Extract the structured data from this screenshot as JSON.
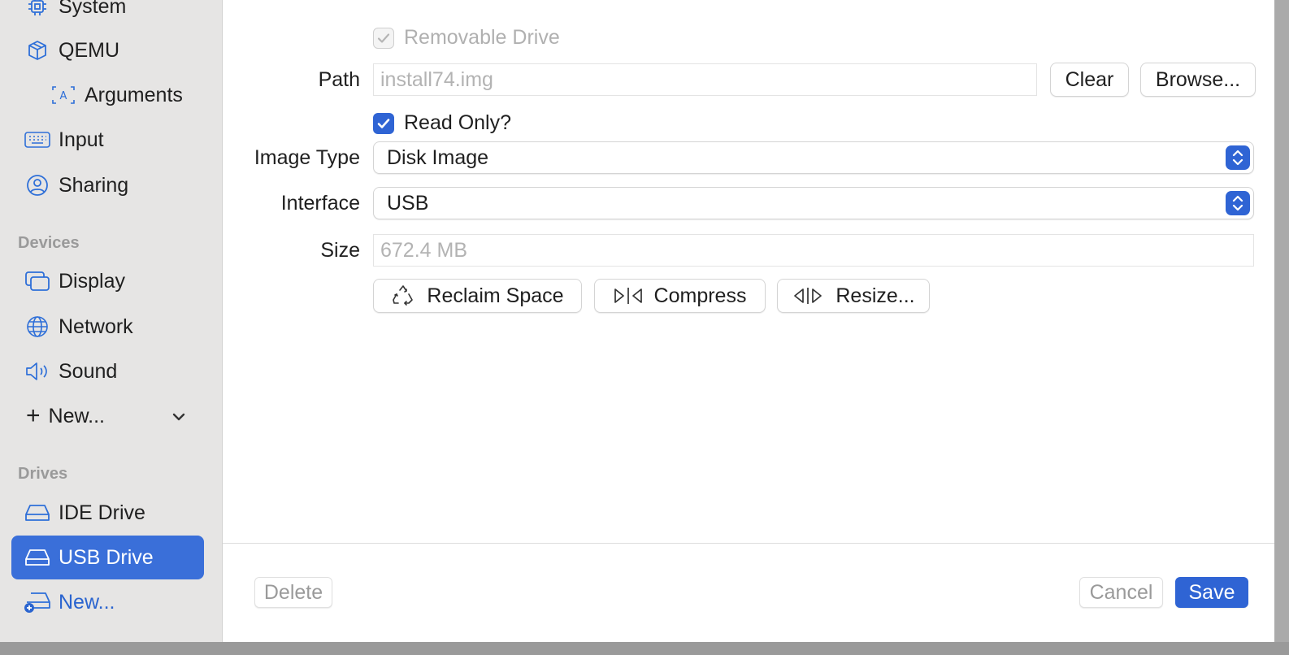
{
  "sidebar": {
    "items_top": [
      {
        "label": "System",
        "icon": "cpu-icon"
      },
      {
        "label": "QEMU",
        "icon": "cube-icon"
      },
      {
        "label": "Arguments",
        "icon": "text-box-icon"
      },
      {
        "label": "Input",
        "icon": "keyboard-icon"
      },
      {
        "label": "Sharing",
        "icon": "person-circle-icon"
      }
    ],
    "devices_header": "Devices",
    "devices": [
      {
        "label": "Display",
        "icon": "display-icon"
      },
      {
        "label": "Network",
        "icon": "globe-icon"
      },
      {
        "label": "Sound",
        "icon": "speaker-icon"
      }
    ],
    "new_device_label": "New...",
    "drives_header": "Drives",
    "drives": [
      {
        "label": "IDE Drive",
        "icon": "drive-icon"
      },
      {
        "label": "USB Drive",
        "icon": "drive-icon",
        "selected": true
      }
    ],
    "new_drive_label": "New..."
  },
  "form": {
    "removable_label": "Removable Drive",
    "path_label": "Path",
    "path_placeholder": "install74.img",
    "clear_label": "Clear",
    "browse_label": "Browse...",
    "read_only_label": "Read Only?",
    "image_type_label": "Image Type",
    "image_type_value": "Disk Image",
    "interface_label": "Interface",
    "interface_value": "USB",
    "size_label": "Size",
    "size_placeholder": "672.4 MB",
    "reclaim_label": "Reclaim Space",
    "compress_label": "Compress",
    "resize_label": "Resize..."
  },
  "footer": {
    "delete_label": "Delete",
    "cancel_label": "Cancel",
    "save_label": "Save"
  },
  "colors": {
    "accent": "#2f64d4",
    "sidebar_bg": "#e6e5e4",
    "selected_bg": "#3a6fd9"
  }
}
